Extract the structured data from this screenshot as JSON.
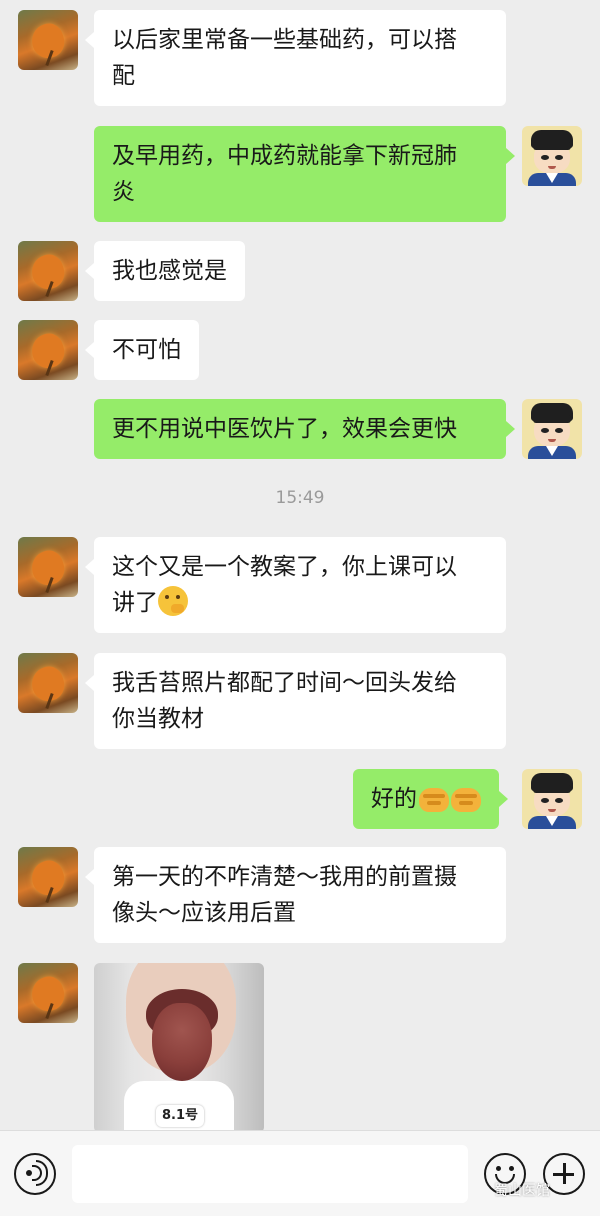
{
  "messages": [
    {
      "side": "left",
      "text": "以后家里常备一些基础药，可以搭配"
    },
    {
      "side": "right",
      "text": "及早用药，中成药就能拿下新冠肺炎"
    },
    {
      "side": "left",
      "text": "我也感觉是"
    },
    {
      "side": "left",
      "text": "不可怕"
    },
    {
      "side": "right",
      "text": "更不用说中医饮片了，效果会更快"
    },
    {
      "side": "left",
      "text": "这个又是一个教案了，你上课可以讲了",
      "emoji": "thinking-face"
    },
    {
      "side": "left",
      "text": "我舌苔照片都配了时间～回头发给你当教材"
    },
    {
      "side": "right",
      "text": "好的",
      "emoji": "handshake"
    },
    {
      "side": "left",
      "text": "第一天的不咋清楚～我用的前置摄像头～应该用后置"
    }
  ],
  "lines": {
    "m1_l1": "以后家里常备一些基础药，可以搭",
    "m1_l2": "配",
    "m2_l1": "及早用药，中成药就能拿下新冠肺",
    "m2_l2": "炎",
    "m3": "我也感觉是",
    "m4": "不可怕",
    "m5": "更不用说中医饮片了，效果会更快",
    "m6_l1": "这个又是一个教案了，你上课可以",
    "m6_l2": "讲了",
    "m7_l1": "我舌苔照片都配了时间～回头发给",
    "m7_l2": "你当教材",
    "m8": "好的",
    "m9_l1": "第一天的不咋清楚～我用的前置摄",
    "m9_l2": "像头～应该用后置"
  },
  "timestamp": "15:49",
  "photo": {
    "tag_label": "8.1号"
  },
  "input_bar": {
    "voice_icon": "voice-icon",
    "emoji_icon": "emoji-icon",
    "plus_icon": "plus-icon"
  },
  "watermark": "蜀山医馆",
  "colors": {
    "background": "#ededed",
    "left_bubble": "#ffffff",
    "right_bubble": "#95ec69",
    "timestamp": "#9a9a9a"
  }
}
